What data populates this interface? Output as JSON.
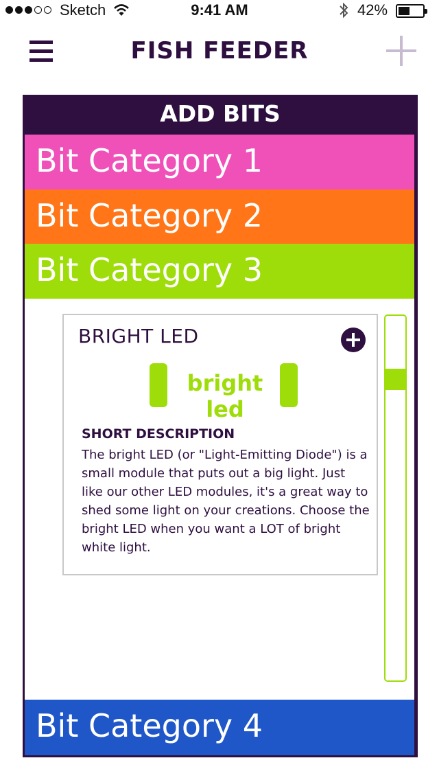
{
  "status_bar": {
    "carrier": "Sketch",
    "time": "9:41 AM",
    "battery": "42%",
    "battery_level": 0.42,
    "signal_bars_filled": 3,
    "icons": [
      "signal-dots-icon",
      "wifi-icon",
      "bluetooth-icon",
      "battery-icon"
    ]
  },
  "nav": {
    "title": "FISH FEEDER",
    "menu_icon": "hamburger-icon",
    "add_icon": "plus-icon"
  },
  "panel": {
    "title": "ADD BITS",
    "categories": [
      {
        "label": "Bit Category 1",
        "color": "#ef51b9"
      },
      {
        "label": "Bit Category 2",
        "color": "#ff7517"
      },
      {
        "label": "Bit Category 3",
        "color": "#9edd0a"
      },
      {
        "label": "Bit Category 4",
        "color": "#1f57c8"
      }
    ],
    "expanded_category": 3
  },
  "bit_card": {
    "title": "BRIGHT LED",
    "add_icon": "plus-circle-icon",
    "module_label": "bright led",
    "description_heading": "SHORT DESCRIPTION",
    "description": "The bright LED (or \"Light-Emitting Diode\") is a small module that puts out a big light. Just like our other LED modules, it's a great way to shed some light on your creations. Choose the bright LED when you want a LOT of bright white light."
  },
  "colors": {
    "primary": "#2e0f40",
    "accent_green": "#9edd0a",
    "add_button_light": "#c7bccf"
  }
}
